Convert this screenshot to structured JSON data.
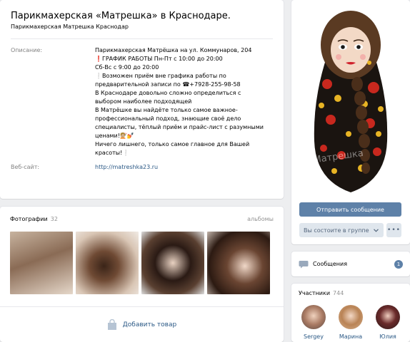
{
  "group": {
    "title": "Парикмахерская «Матрешка» в Краснодаре.",
    "subtitle": "Парикмахерская Матрешка Краснодар"
  },
  "info": {
    "description_label": "Описание:",
    "description_lines": [
      "Парикмахерская Матрёшка на ул. Коммунаров, 204",
      "❗ГРАФИК РАБОТЫ Пн-Пт с 10:00 до 20:00",
      "Сб-Вс с 9:00 до 20:00",
      "❕Возможен приём вне графика работы по",
      "предварительной записи по ☎+7928-255-98-58",
      "В Краснодаре довольно сложно определиться с",
      "выбором наиболее подходящей",
      "В Матрёшке вы найдёте только самое важное-",
      "профессиональный подход, знающие своё дело",
      "специалисты, тёплый приём и прайс-лист с разумными",
      "ценами!💇🏼💅",
      "Ничего лишнего, только самое главное для Вашей",
      "красоты!❕"
    ],
    "website_label": "Веб-сайт:",
    "website": "http://matreshka23.ru"
  },
  "photos": {
    "title": "Фотографии",
    "count": "32",
    "all_label": "альбомы",
    "add_goods_label": "Добавить товар"
  },
  "sidebar": {
    "send_message": "Отправить сообщение",
    "member_status": "Вы состоите в группе",
    "more": "•••",
    "messages_label": "Сообщения",
    "messages_badge": "1",
    "members_title": "Участники",
    "members_count": "744",
    "members": [
      {
        "name": "Sergey"
      },
      {
        "name": "Марина"
      },
      {
        "name": "Юлия"
      }
    ]
  },
  "colors": {
    "accent": "#5e81a8",
    "link": "#2a5885",
    "background": "#edeef0"
  }
}
